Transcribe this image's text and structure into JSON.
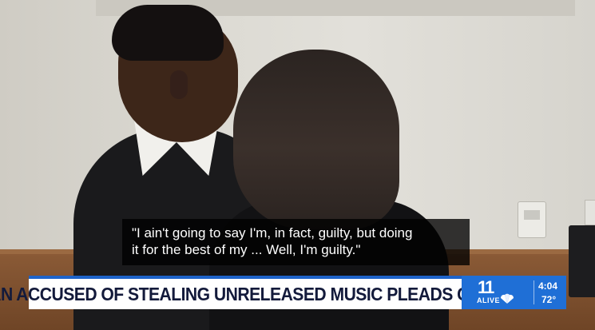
{
  "caption": {
    "line1": "\"I ain't going to say I'm, in fact, guilty, but doing",
    "line2": "it for the best of my ... Well, I'm guilty.\""
  },
  "lower_third": {
    "headline": "MAN ACCUSED OF STEALING UNRELEASED MUSIC PLEADS GUILTY"
  },
  "station_bug": {
    "logo_number": "11",
    "logo_word": "ALIVE",
    "time": "4:04",
    "temperature": "72°",
    "logo_icon": "peacock-icon"
  },
  "colors": {
    "lower_third_bg": "#ffffff",
    "lower_third_accent": "#1e63c9",
    "headline_text": "#131a3b",
    "bug_bg": "#1f6fd6",
    "caption_bg": "rgba(0,0,0,0.78)"
  }
}
